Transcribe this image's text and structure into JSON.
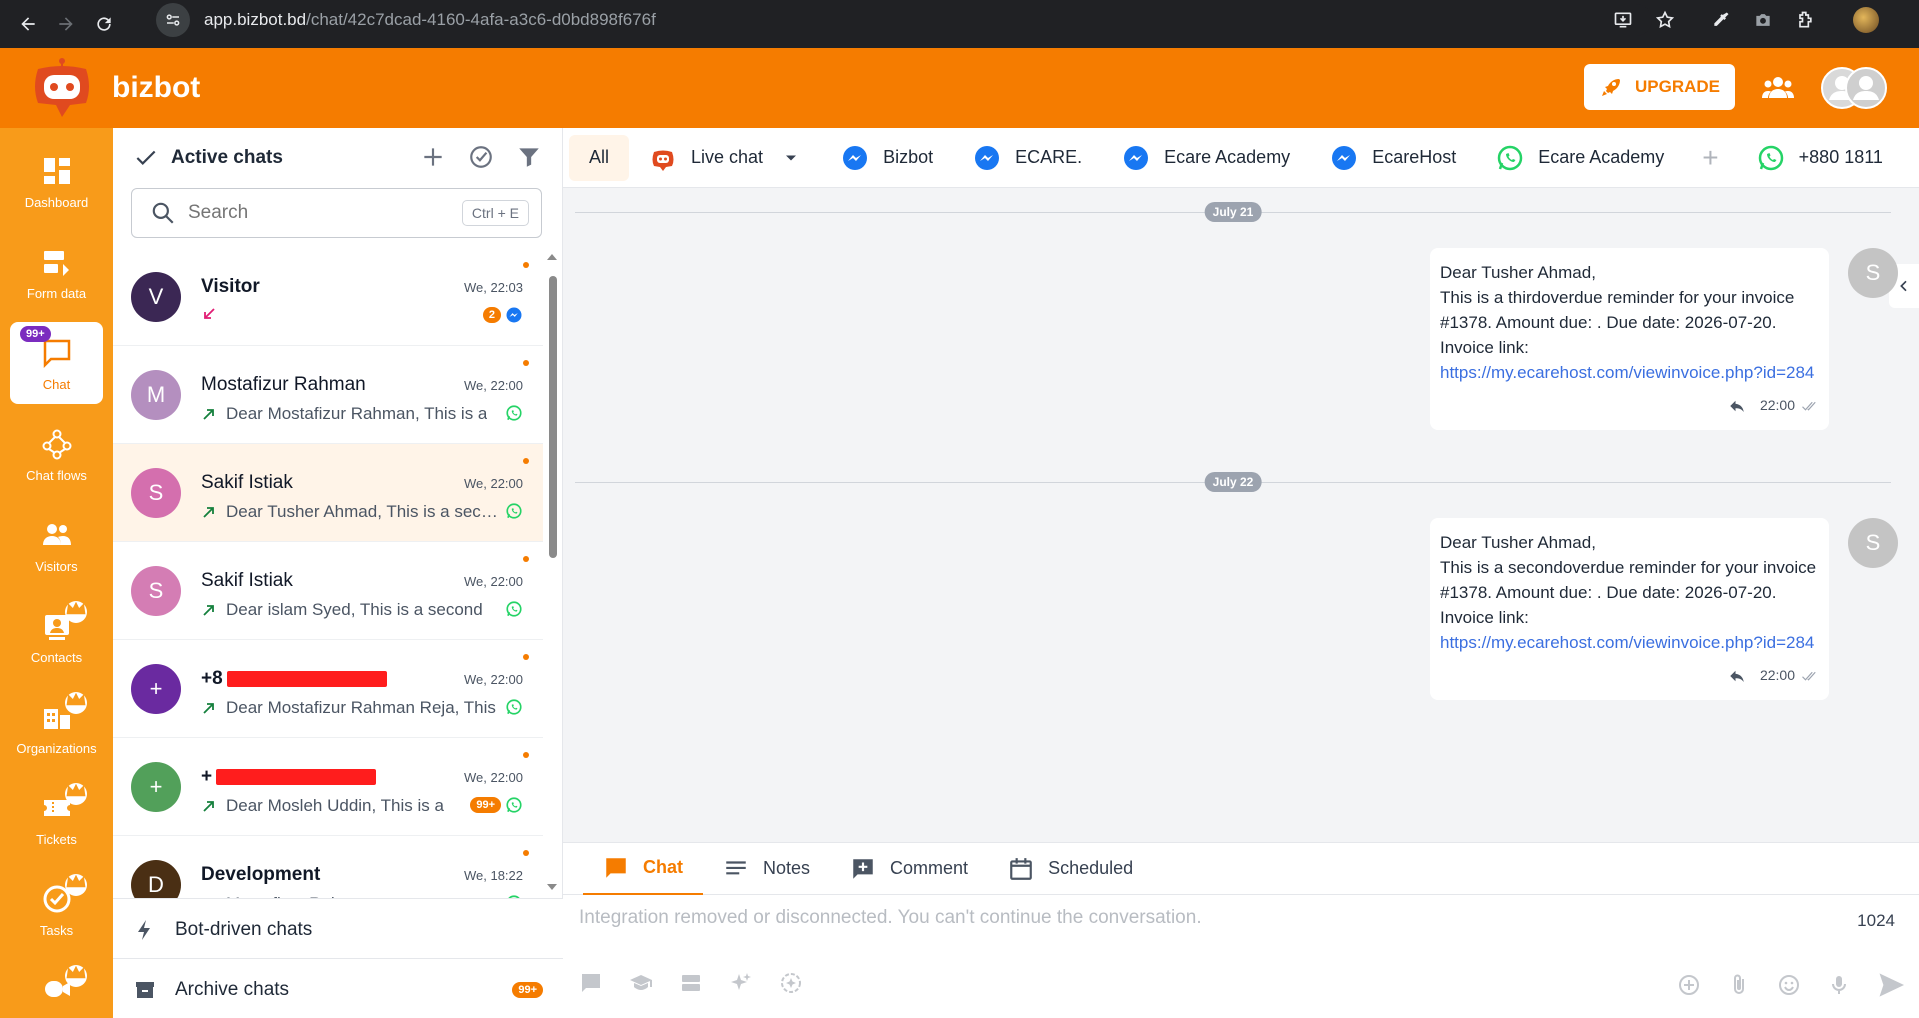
{
  "browser": {
    "url_host": "app.bizbot.bd",
    "url_path": "/chat/42c7dcad-4160-4afa-a3c6-d0bd898f676f"
  },
  "header": {
    "brand": "bizbot",
    "upgrade_label": "UPGRADE"
  },
  "rail": {
    "items": [
      {
        "label": "Dashboard"
      },
      {
        "label": "Form data"
      },
      {
        "label": "Chat",
        "badge": "99+"
      },
      {
        "label": "Chat flows"
      },
      {
        "label": "Visitors"
      },
      {
        "label": "Contacts"
      },
      {
        "label": "Organizations"
      },
      {
        "label": "Tickets"
      },
      {
        "label": "Tasks"
      }
    ]
  },
  "chatlist": {
    "title": "Active chats",
    "search_placeholder": "Search",
    "shortcut": "Ctrl + E",
    "rows": [
      {
        "name": "Visitor",
        "time": "We, 22:03",
        "preview": "",
        "avatar": "V",
        "avatar_color": "#3b2754",
        "badge": "2",
        "channel": "messenger"
      },
      {
        "name": "Mostafizur Rahman",
        "time": "We, 22:00",
        "preview": "Dear Mostafizur Rahman, This is a",
        "avatar": "M",
        "avatar_color": "#b48fbf",
        "badge": "",
        "channel": "whatsapp"
      },
      {
        "name": "Sakif Istiak",
        "time": "We, 22:00",
        "preview": "Dear Tusher Ahmad, This is a second",
        "avatar": "S",
        "avatar_color": "#d46fae",
        "badge": "",
        "channel": "whatsapp"
      },
      {
        "name": "Sakif Istiak",
        "time": "We, 22:00",
        "preview": "Dear islam Syed, This is a second",
        "avatar": "S",
        "avatar_color": "#d47db4",
        "badge": "",
        "channel": "whatsapp"
      },
      {
        "name": "+8",
        "time": "We, 22:00",
        "preview": "Dear Mostafizur Rahman Reja, This",
        "avatar": "+",
        "avatar_color": "#6a2aa0",
        "badge": "",
        "channel": "whatsapp"
      },
      {
        "name": "+",
        "time": "We, 22:00",
        "preview": "Dear Mosleh Uddin, This is a",
        "avatar": "+",
        "avatar_color": "#52a05a",
        "badge": "99+",
        "channel": "whatsapp"
      },
      {
        "name": "Development",
        "time": "We, 18:22",
        "preview": "Mostafizur Rahman",
        "avatar": "D",
        "avatar_color": "#4a2f14",
        "badge": "",
        "channel": "whatsapp"
      }
    ],
    "bot_driven": "Bot-driven chats",
    "archive": "Archive chats",
    "archive_badge": "99+"
  },
  "tabs": [
    {
      "label": "All"
    },
    {
      "label": "Live chat"
    },
    {
      "label": "Bizbot"
    },
    {
      "label": "ECARE."
    },
    {
      "label": "Ecare Academy"
    },
    {
      "label": "EcareHost"
    },
    {
      "label": "Ecare Academy"
    },
    {
      "label": "+880 1811"
    }
  ],
  "messages": {
    "date1": "July 21",
    "date2": "July 22",
    "msg1": {
      "line1": "Dear Tusher Ahmad,",
      "body": "This is a thirdoverdue reminder for your invoice #1378. Amount due: . Due date: 2026-07-20.",
      "link_label": "Invoice link:",
      "link": "https://my.ecarehost.com/viewinvoice.php?id=284",
      "time": "22:00",
      "avatar": "S"
    },
    "msg2": {
      "line1": "Dear Tusher Ahmad,",
      "body": "This is a secondoverdue reminder for your invoice #1378. Amount due: . Due date: 2026-07-20.",
      "link_label": "Invoice link:",
      "link": "https://my.ecarehost.com/viewinvoice.php?id=284",
      "time": "22:00",
      "avatar": "S"
    }
  },
  "composer": {
    "tabs": [
      "Chat",
      "Notes",
      "Comment",
      "Scheduled"
    ],
    "placeholder": "Integration removed or disconnected. You can't continue the conversation.",
    "char_count": "1024"
  },
  "colors": {
    "brand_orange": "#f57c00",
    "rail_orange": "#f89b1a",
    "messenger_blue": "#1877f2",
    "whatsapp_green": "#25d366"
  }
}
